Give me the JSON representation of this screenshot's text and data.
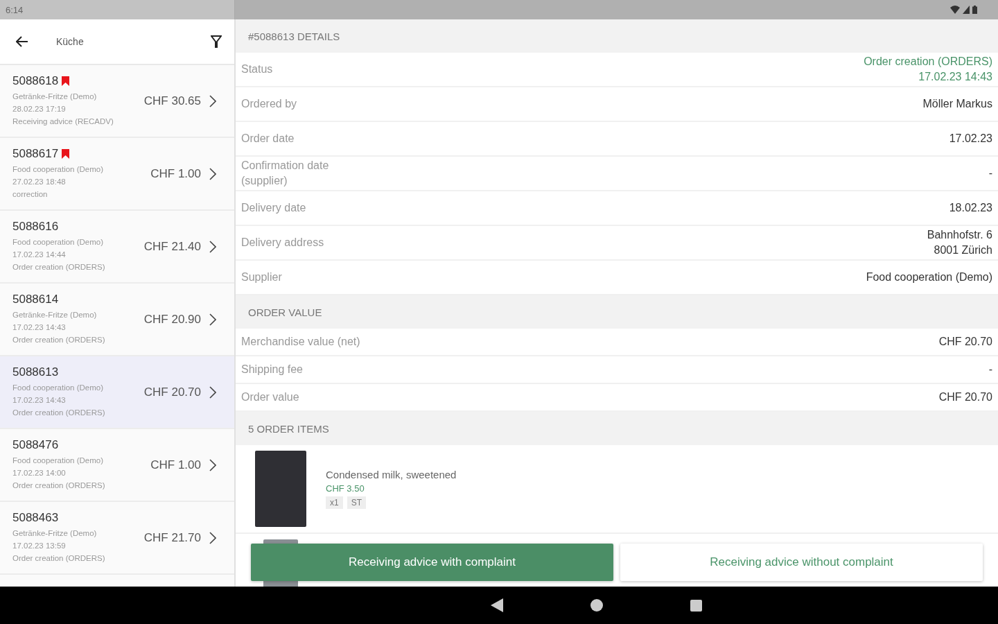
{
  "status_bar": {
    "time": "6:14"
  },
  "list_header": {
    "title": "Küche"
  },
  "orders": [
    {
      "number": "5088618",
      "flagged": true,
      "supplier": "Getränke-Fritze (Demo)",
      "datetime": "28.02.23 17:19",
      "status": "Receiving advice (RECADV)",
      "amount": "CHF 30.65",
      "selected": false
    },
    {
      "number": "5088617",
      "flagged": true,
      "supplier": "Food cooperation (Demo)",
      "datetime": "27.02.23 18:48",
      "status": "correction",
      "amount": "CHF 1.00",
      "selected": false
    },
    {
      "number": "5088616",
      "flagged": false,
      "supplier": "Food cooperation (Demo)",
      "datetime": "17.02.23 14:44",
      "status": "Order creation (ORDERS)",
      "amount": "CHF 21.40",
      "selected": false
    },
    {
      "number": "5088614",
      "flagged": false,
      "supplier": "Getränke-Fritze (Demo)",
      "datetime": "17.02.23 14:43",
      "status": "Order creation (ORDERS)",
      "amount": "CHF 20.90",
      "selected": false
    },
    {
      "number": "5088613",
      "flagged": false,
      "supplier": "Food cooperation (Demo)",
      "datetime": "17.02.23 14:43",
      "status": "Order creation (ORDERS)",
      "amount": "CHF 20.70",
      "selected": true
    },
    {
      "number": "5088476",
      "flagged": false,
      "supplier": "Food cooperation (Demo)",
      "datetime": "17.02.23 14:00",
      "status": "Order creation (ORDERS)",
      "amount": "CHF 1.00",
      "selected": false
    },
    {
      "number": "5088463",
      "flagged": false,
      "supplier": "Getränke-Fritze (Demo)",
      "datetime": "17.02.23 13:59",
      "status": "Order creation (ORDERS)",
      "amount": "CHF 21.70",
      "selected": false
    }
  ],
  "details": {
    "heading": "#5088613 DETAILS",
    "rows": [
      {
        "label": "Status",
        "value": [
          "Order creation (ORDERS)",
          "17.02.23 14:43"
        ],
        "kind": "status"
      },
      {
        "label": "Ordered by",
        "value": [
          "Möller Markus"
        ],
        "kind": "plain"
      },
      {
        "label": "Order date",
        "value": [
          "17.02.23"
        ],
        "kind": "plain"
      },
      {
        "label": "Confirmation date (supplier)",
        "value": [
          "-"
        ],
        "kind": "plain"
      },
      {
        "label": "Delivery date",
        "value": [
          "18.02.23"
        ],
        "kind": "plain"
      },
      {
        "label": "Delivery address",
        "value": [
          "Bahnhofstr. 6",
          "8001 Zürich"
        ],
        "kind": "plain"
      },
      {
        "label": "Supplier",
        "value": [
          "Food cooperation (Demo)"
        ],
        "kind": "plain"
      }
    ]
  },
  "order_value": {
    "heading": "ORDER VALUE",
    "rows": [
      {
        "label": "Merchandise value (net)",
        "value": "CHF 20.70"
      },
      {
        "label": "Shipping fee",
        "value": "-"
      },
      {
        "label": "Order value",
        "value": "CHF 20.70"
      }
    ]
  },
  "order_items": {
    "heading": "5 ORDER ITEMS",
    "items": [
      {
        "name": "Condensed milk, sweetened",
        "price": "CHF 3.50",
        "quantity": "x1",
        "unit": "ST"
      }
    ]
  },
  "actions": [
    {
      "label": "Receiving advice with complaint",
      "kind": "primary"
    },
    {
      "label": "Receiving advice without complaint",
      "kind": "secondary"
    }
  ]
}
